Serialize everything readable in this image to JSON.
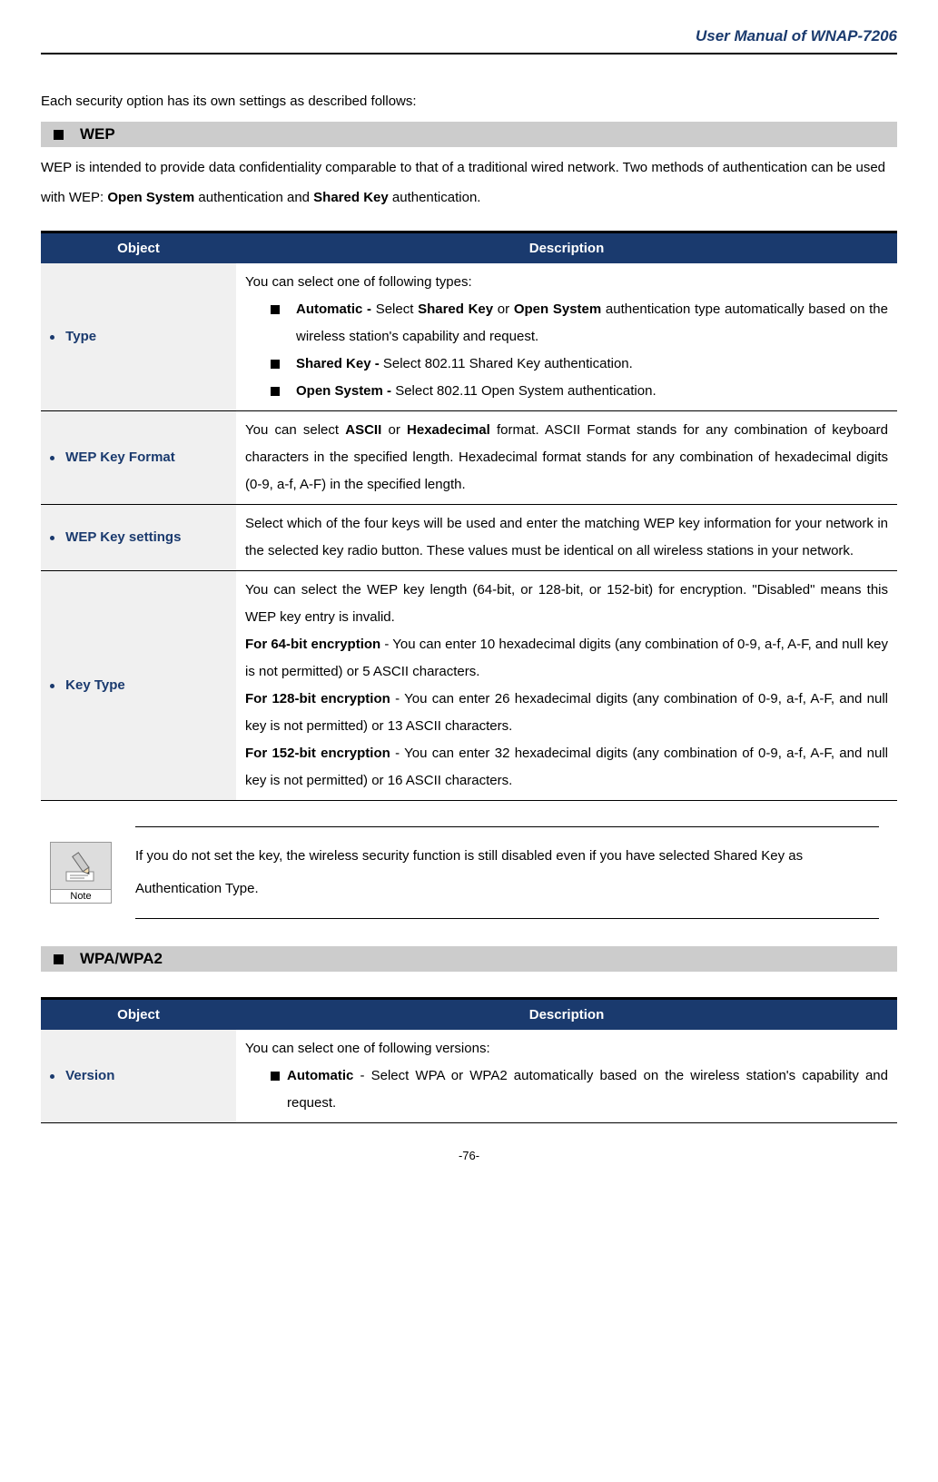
{
  "header": {
    "title": "User Manual of WNAP-7206"
  },
  "intro": "Each security option has its own settings as described follows:",
  "sections": {
    "wep": {
      "heading": "WEP",
      "description_parts": {
        "p1": "WEP is intended to provide data confidentiality comparable to that of a traditional wired network. Two methods of authentication can be used with WEP: ",
        "b1": "Open System",
        "p2": " authentication and ",
        "b2": "Shared Key",
        "p3": " authentication."
      },
      "table_headers": {
        "object": "Object",
        "description": "Description"
      },
      "rows": {
        "type": {
          "label": "Type",
          "intro": "You can select one of following types:",
          "items": {
            "auto": {
              "b1": "Automatic -",
              "t1": " Select ",
              "b2": "Shared Key",
              "t2": " or ",
              "b3": "Open System",
              "t3": " authentication type automatically based on the wireless station's capability and request."
            },
            "shared": {
              "b1": "Shared Key - ",
              "t1": "  Select 802.11 Shared Key authentication."
            },
            "open": {
              "b1": "Open System - ",
              "t1": "Select 802.11 Open System authentication."
            }
          }
        },
        "wepkeyformat": {
          "label": "WEP Key Format",
          "desc": {
            "t1": "You can select ",
            "b1": "ASCII",
            "t2": " or ",
            "b2": "Hexadecimal",
            "t3": " format. ASCII Format stands for any combination of keyboard characters in the specified length. Hexadecimal format stands for any combination of hexadecimal digits (0-9, a-f, A-F) in the specified length."
          }
        },
        "wepkeysettings": {
          "label": "WEP Key settings",
          "desc": "Select which of the four keys will be used and enter the matching WEP key information for your network in the selected key radio button. These values must be identical on all wireless stations in your network."
        },
        "keytype": {
          "label": "Key Type",
          "desc": {
            "p1": "You can select the WEP key length (64-bit, or 128-bit, or 152-bit) for encryption. \"Disabled\" means this WEP key entry is invalid.",
            "b64": "For 64-bit encryption",
            "t64": " - You can enter 10 hexadecimal digits (any combination of 0-9, a-f, A-F, and null key is not permitted) or 5 ASCII characters.",
            "b128": "For 128-bit encryption",
            "t128": " - You can enter 26 hexadecimal digits (any combination of 0-9, a-f, A-F, and null key is not permitted) or 13 ASCII characters.",
            "b152": "For 152-bit encryption",
            "t152": " - You can enter 32 hexadecimal digits (any combination of 0-9, a-f, A-F, and null key is not permitted) or 16 ASCII characters."
          }
        }
      },
      "note": {
        "icon_label": "Note",
        "text": "If you do not set the key, the wireless security function is still disabled even if you have selected Shared Key as Authentication Type."
      }
    },
    "wpa": {
      "heading": "WPA/WPA2",
      "table_headers": {
        "object": "Object",
        "description": "Description"
      },
      "rows": {
        "version": {
          "label": "Version",
          "intro": "You can select one of following versions:",
          "items": {
            "auto": {
              "b1": "Automatic",
              "t1": " - Select WPA or WPA2 automatically based on the wireless station's capability and request."
            }
          }
        }
      }
    }
  },
  "footer": {
    "page": "-76-"
  }
}
